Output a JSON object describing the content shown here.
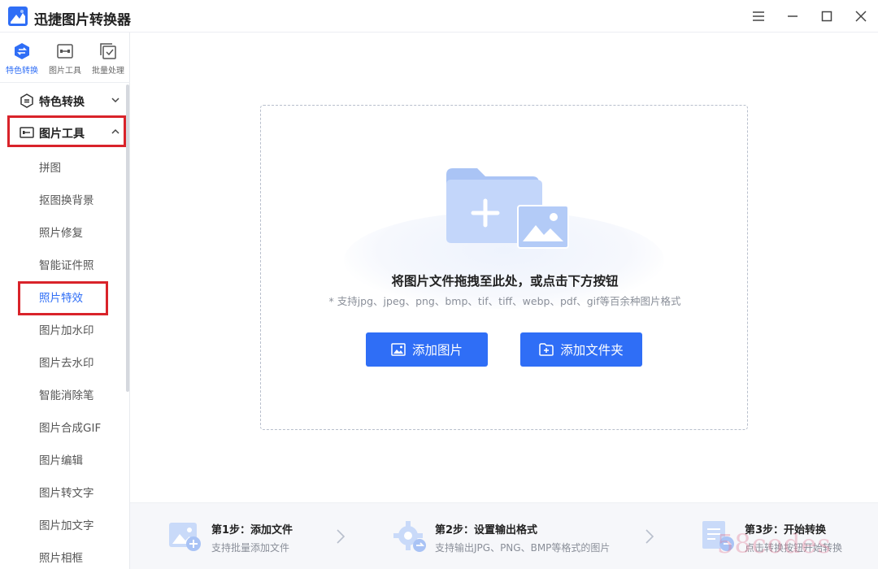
{
  "app": {
    "title": "迅捷图片转换器"
  },
  "top_tabs": [
    {
      "label": "特色转换",
      "icon": "convert-icon"
    },
    {
      "label": "图片工具",
      "icon": "image-tool-icon"
    },
    {
      "label": "批量处理",
      "icon": "batch-icon"
    }
  ],
  "sidebar": {
    "sections": [
      {
        "label": "特色转换",
        "icon": "convert-icon",
        "expanded": false
      },
      {
        "label": "图片工具",
        "icon": "image-tool-icon",
        "expanded": true
      }
    ],
    "tools": [
      "拼图",
      "抠图换背景",
      "照片修复",
      "智能证件照",
      "照片特效",
      "图片加水印",
      "图片去水印",
      "智能消除笔",
      "图片合成GIF",
      "图片编辑",
      "图片转文字",
      "图片加文字",
      "照片相框"
    ],
    "active_tool": "照片特效"
  },
  "dropzone": {
    "title": "将图片文件拖拽至此处，或点击下方按钮",
    "hint": "* 支持jpg、jpeg、png、bmp、tif、tiff、webp、pdf、gif等百余种图片格式",
    "add_image": "添加图片",
    "add_folder": "添加文件夹"
  },
  "steps": [
    {
      "title": "第1步：添加文件",
      "desc": "支持批量添加文件"
    },
    {
      "title": "第2步：设置输出格式",
      "desc": "支持输出JPG、PNG、BMP等格式的图片"
    },
    {
      "title": "第3步：开始转换",
      "desc": "点击转换按钮开始转换"
    }
  ],
  "watermark": "58codes",
  "colors": {
    "accent": "#2f6ef6",
    "highlight_box": "#d9232a"
  }
}
